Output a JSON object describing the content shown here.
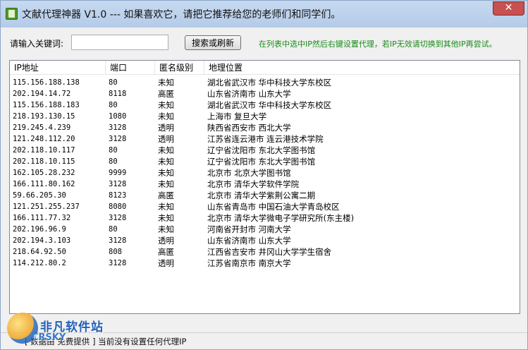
{
  "window": {
    "title": "文献代理神器 V1.0  ---  如果喜欢它，请把它推荐给您的老师们和同学们。",
    "close_label": "✕"
  },
  "search": {
    "label": "请输入关键词:",
    "value": "",
    "placeholder": "",
    "button_label": "搜索或刷新",
    "hint": "在列表中选中IP然后右键设置代理，若IP无效请切换到其他IP再尝试。"
  },
  "table": {
    "columns": [
      "IP地址",
      "端口",
      "匿名级别",
      "地理位置"
    ],
    "rows": [
      [
        "115.156.188.138",
        "80",
        "未知",
        "湖北省武汉市 华中科技大学东校区"
      ],
      [
        "202.194.14.72",
        "8118",
        "高匿",
        "山东省济南市 山东大学"
      ],
      [
        "115.156.188.183",
        "80",
        "未知",
        "湖北省武汉市 华中科技大学东校区"
      ],
      [
        "218.193.130.15",
        "1080",
        "未知",
        "上海市 复旦大学"
      ],
      [
        "219.245.4.239",
        "3128",
        "透明",
        "陕西省西安市 西北大学"
      ],
      [
        "121.248.112.20",
        "3128",
        "透明",
        "江苏省连云港市 连云港技术学院"
      ],
      [
        "202.118.10.117",
        "80",
        "未知",
        "辽宁省沈阳市 东北大学图书馆"
      ],
      [
        "202.118.10.115",
        "80",
        "未知",
        "辽宁省沈阳市 东北大学图书馆"
      ],
      [
        "162.105.28.232",
        "9999",
        "未知",
        "北京市 北京大学图书馆"
      ],
      [
        "166.111.80.162",
        "3128",
        "未知",
        "北京市 清华大学软件学院"
      ],
      [
        "59.66.205.30",
        "8123",
        "高匿",
        "北京市 清华大学紫荆公寓二期"
      ],
      [
        "121.251.255.237",
        "8080",
        "未知",
        "山东省青岛市 中国石油大学青岛校区"
      ],
      [
        "166.111.77.32",
        "3128",
        "未知",
        "北京市 清华大学微电子学研究所(东主楼)"
      ],
      [
        "202.196.96.9",
        "80",
        "未知",
        "河南省开封市 河南大学"
      ],
      [
        "202.194.3.103",
        "3128",
        "透明",
        "山东省济南市 山东大学"
      ],
      [
        "218.64.92.50",
        "808",
        "高匿",
        "江西省吉安市 井冈山大学学生宿舍"
      ],
      [
        "114.212.80.2",
        "3128",
        "透明",
        "江苏省南京市 南京大学"
      ]
    ]
  },
  "status": {
    "text": "[ 数据由 免费提供 ]  当前没有设置任何代理IP"
  },
  "watermark": {
    "cn": "非凡软件站",
    "en": "CRSKY"
  },
  "colors": {
    "hint": "#1a8a1a",
    "close": "#c75050",
    "titlebar": "#c6d9f0"
  }
}
